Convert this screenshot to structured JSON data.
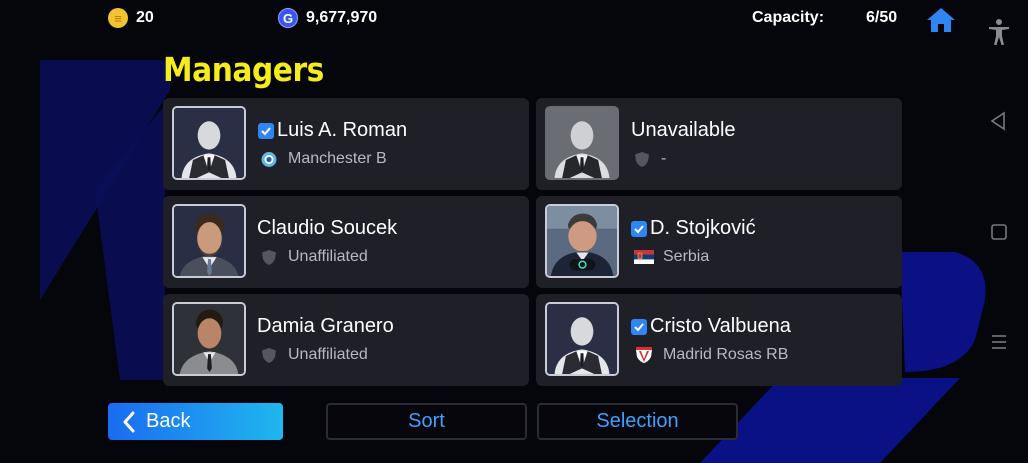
{
  "topbar": {
    "efootball_coins": "20",
    "gp": "9,677,970",
    "capacity_label": "Capacity:",
    "capacity_value": "6/50"
  },
  "title": "Managers",
  "managers": [
    {
      "name": "Luis A. Roman",
      "club": "Manchester B",
      "checked": true,
      "available": true
    },
    {
      "name": "Unavailable",
      "club": "-",
      "checked": false,
      "available": false
    },
    {
      "name": "Claudio Soucek",
      "club": "Unaffiliated",
      "checked": false,
      "available": true
    },
    {
      "name": "D. Stojković",
      "club": "Serbia",
      "checked": true,
      "available": true
    },
    {
      "name": "Damia Granero",
      "club": "Unaffiliated",
      "checked": false,
      "available": true
    },
    {
      "name": "Cristo Valbuena",
      "club": "Madrid Rosas RB",
      "checked": true,
      "available": true
    }
  ],
  "buttons": {
    "back": "Back",
    "sort": "Sort",
    "selection": "Selection"
  },
  "colors": {
    "title": "#f5ec1b",
    "card_bg": "#1e1f27",
    "accent_blue": "#3ea0ff",
    "check_blue": "#2f86f2"
  }
}
